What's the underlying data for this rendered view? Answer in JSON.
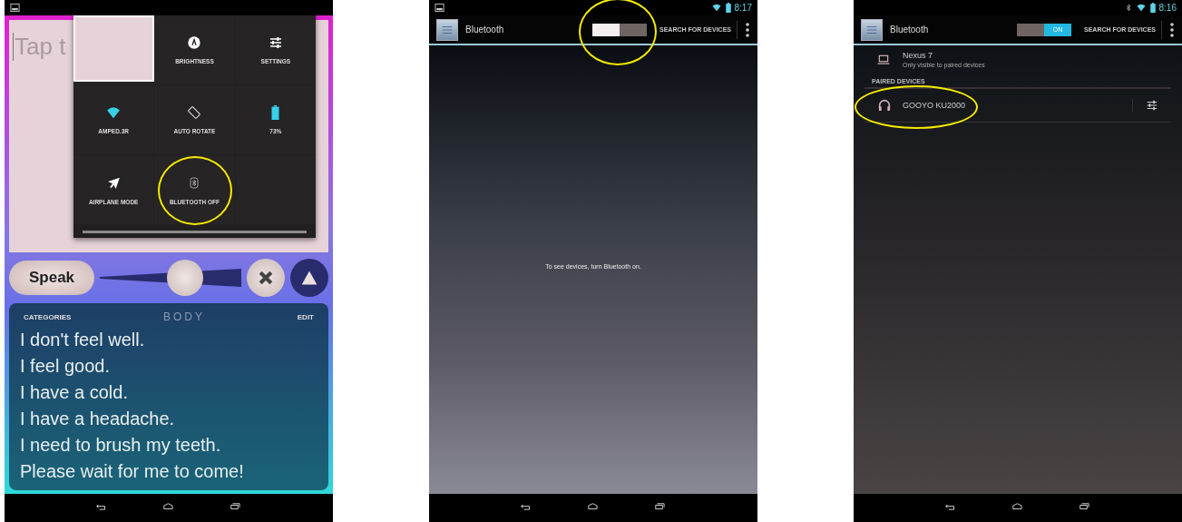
{
  "screens": [
    {
      "kind": "phrase_app",
      "status_bar": {
        "screenshot_notification": true
      },
      "text_field": {
        "placeholder": "Tap t"
      },
      "quick_settings": {
        "tiles": [
          {
            "kind": "photo",
            "circled": false
          },
          {
            "kind": "brightness",
            "label": "BRIGHTNESS",
            "circled": false
          },
          {
            "kind": "settings",
            "label": "SETTINGS",
            "circled": false
          },
          {
            "kind": "wifi",
            "label": "AMPED.3R",
            "circled": false
          },
          {
            "kind": "rotate",
            "label": "AUTO ROTATE",
            "circled": false
          },
          {
            "kind": "battery",
            "label": "73%",
            "circled": false
          },
          {
            "kind": "airplane",
            "label": "AIRPLANE MODE",
            "circled": false
          },
          {
            "kind": "bluetooth",
            "label": "BLUETOOTH OFF",
            "circled": true
          },
          {
            "kind": "empty",
            "circled": false
          }
        ]
      },
      "controls": {
        "speak": "Speak",
        "volume": {
          "level": 0.6
        }
      },
      "phrases": {
        "left": "CATEGORIES",
        "title": "BODY",
        "right": "EDIT",
        "items": [
          "I don't feel well.",
          "I feel good.",
          "I have a cold.",
          "I have a headache.",
          "I need to brush my teeth.",
          "Please wait for me to come!"
        ]
      }
    },
    {
      "kind": "bluetooth_settings",
      "status_bar": {
        "screenshot_notification": true,
        "time": "8:17"
      },
      "action_bar": {
        "title": "Bluetooth",
        "switch": {
          "on": false,
          "circled": true
        },
        "action": "SEARCH FOR DEVICES"
      },
      "message": "To see devices, turn Bluetooth on."
    },
    {
      "kind": "bluetooth_settings",
      "status_bar": {
        "screenshot_notification": false,
        "time": "8:16"
      },
      "action_bar": {
        "title": "Bluetooth",
        "switch": {
          "on": true,
          "label": "ON",
          "circled": false
        },
        "action": "SEARCH FOR DEVICES"
      },
      "this_device": {
        "name": "Nexus 7",
        "subtitle": "Only visible to paired devices"
      },
      "section": "PAIRED DEVICES",
      "devices": [
        {
          "name": "GOOYO KU2000",
          "circled": true
        }
      ]
    }
  ]
}
